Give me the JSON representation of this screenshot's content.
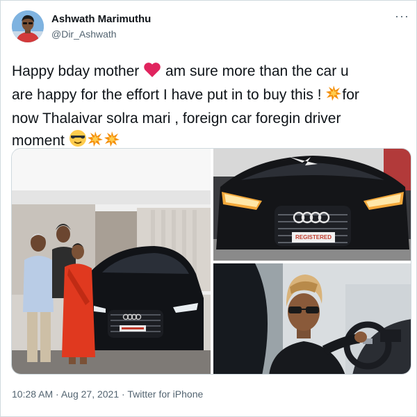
{
  "author": {
    "name": "Ashwath Marimuthu",
    "handle": "@Dir_Ashwath",
    "avatar_icon": "avatar-photo"
  },
  "menu": {
    "more_label": "···"
  },
  "tweet": {
    "line1_a": "Happy bday mother ",
    "line1_b": " am sure more than the car u",
    "line2_a": "are happy for the effort I have put in to buy this ! ",
    "line2_b": "for",
    "line3": "now Thalaivar solra mari , foreign car foregin driver",
    "line4": "moment ",
    "emojis": [
      "red-heart",
      "collision",
      "smiling-face-with-sunglasses",
      "collision",
      "collision"
    ]
  },
  "media": {
    "plate_text": "REGISTERED",
    "photos": [
      "family-with-audi-car",
      "audi-front-headlights",
      "man-in-driver-seat"
    ]
  },
  "meta": {
    "time": "10:28 AM",
    "sep1": " · ",
    "date": "Aug 27, 2021",
    "sep2": " · ",
    "source": "Twitter for iPhone"
  },
  "colors": {
    "text": "#0f1419",
    "secondary": "#536471",
    "border": "#cfd9de",
    "heart": "#e0245e"
  }
}
